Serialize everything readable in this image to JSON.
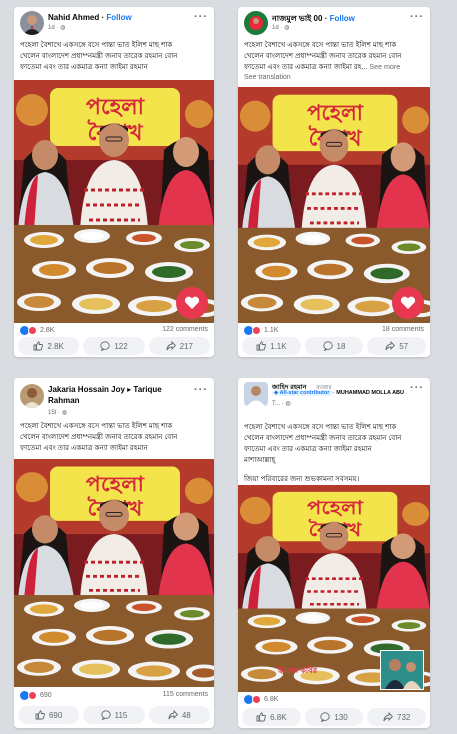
{
  "posts": [
    {
      "author": "Nahid Ahmed",
      "follow": "Follow",
      "meta": "1d ·",
      "lines": [
        "পহেলা বৈশাখে একসঙ্গে বসে পান্তা ভাত ইলিশ মাছ শাক",
        "খেলেন বাংলাদেশ প্রধা**নমন্ত্রী জনাব তারেক রহমান বোন",
        "ফাতেমা এবং তার একমাত্র কন্যা জাইমা রহমান"
      ],
      "banner": "পহেলা বৈশাখ",
      "reactions": "2.8K",
      "comments": "122 comments",
      "likes": "2.8K",
      "comment_count": "122",
      "shares": "217"
    },
    {
      "author": "নাজমুল ভাই 00",
      "follow": "Follow",
      "meta": "1d ·",
      "lines": [
        "পহেলা বৈশাখে একসঙ্গে বসে পান্তা ভাত ইলিশ মাছ শাক",
        "খেলেন বাংলাদেশ প্রধা**নমন্ত্রী জনাব তারেক রহমান বোন",
        "ফাতেমা এবং তার একমাত্র কন্যা জাইমা রহ..."
      ],
      "see_more": "See more",
      "see_translation": "See translation",
      "banner": "পহেলা বৈশাখ",
      "reactions": "1.1K",
      "comments": "18 comments",
      "likes": "1.1K",
      "comment_count": "18",
      "shares": "57"
    },
    {
      "author": "Jakaria Hossain Joy ▸ Tarique",
      "author2": "Rahman",
      "meta": "15t ·",
      "lines": [
        "পহেলা বৈশাখে একসঙ্গে বসে পান্তা ভাত ইলিশ মাছ শাক",
        "খেলেন বাংলাদেশ প্রধা**নমন্ত্রী জনাব তারেক রহমান বোন",
        "ফাতেমা এবং তার একমাত্র কন্যা জাইমা রহমান"
      ],
      "banner": "পহেলা বৈশাখ",
      "reactions": "690",
      "comments": "115 comments",
      "likes": "690",
      "comment_count": "115",
      "shares": "48"
    },
    {
      "author": "জাহিদ রহমান",
      "group_label": "ব্যবহার",
      "badge": "All-star contributor",
      "tagline": "MUHAMMAD MOLLA ABU",
      "meta": "T... ·",
      "lines": [
        "পহেলা বৈশাখে একসঙ্গে বসে পান্তা ভাত ইলিশ মাছ শাক",
        "খেলেন বাংলাদেশ প্রধা**নমন্ত্রী জনাব তারেক রহমান বোন",
        "ফাতেমা এবং তার একমাত্র কন্যা জাইমা রহমান",
        "মাশাআল্লাহ্",
        "",
        "জিয়া পরিবারের জন্য শুভকামনা সবসময়।"
      ],
      "banner": "পহেলা বৈশাখ",
      "caption": "ইমরান কবির",
      "reactions": "6.8K",
      "likes": "6.8K",
      "comment_count": "130",
      "shares": "732"
    }
  ],
  "colors": {
    "accent": "#1877f2",
    "banner_bg": "#f4e44c",
    "banner_text": "#d6283b",
    "love": "#f33e58"
  }
}
